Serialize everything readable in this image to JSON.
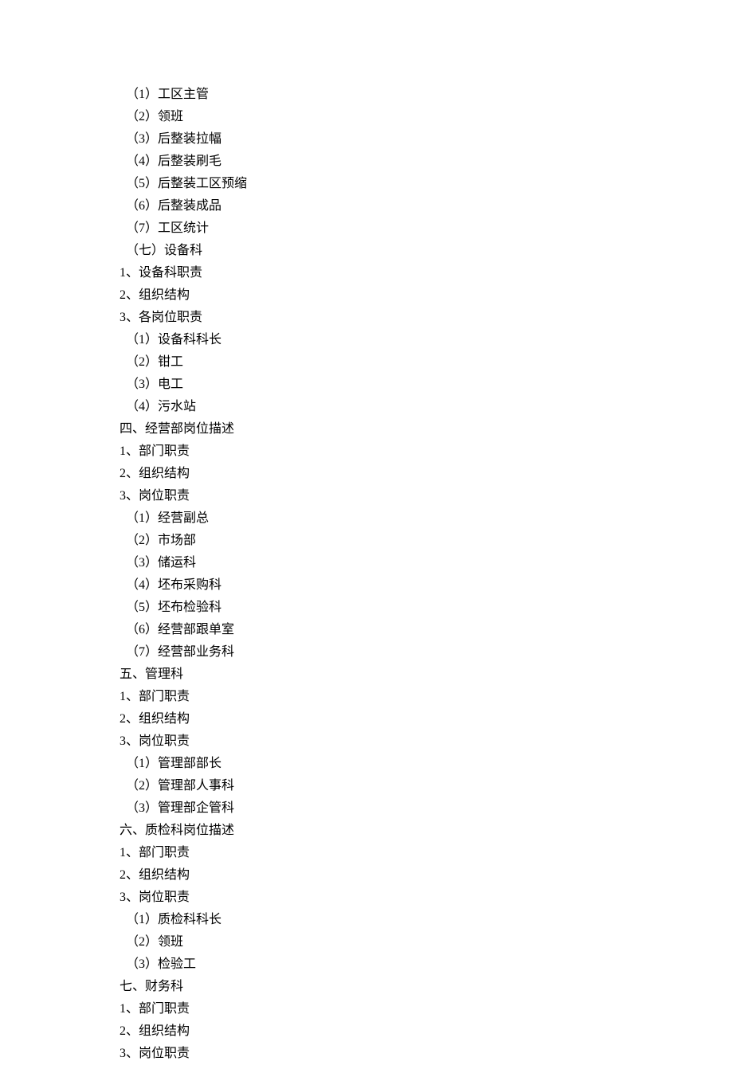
{
  "lines": [
    {
      "text": "（1）工区主管",
      "indent": 1
    },
    {
      "text": "（2）领班",
      "indent": 1
    },
    {
      "text": "（3）后整装拉幅",
      "indent": 1
    },
    {
      "text": "（4）后整装刷毛",
      "indent": 1
    },
    {
      "text": "（5）后整装工区预缩",
      "indent": 1
    },
    {
      "text": "（6）后整装成品",
      "indent": 1
    },
    {
      "text": "（7）工区统计",
      "indent": 1
    },
    {
      "text": "（七）设备科",
      "indent": 1
    },
    {
      "text": "1、设备科职责",
      "indent": 0
    },
    {
      "text": "2、组织结构",
      "indent": 0
    },
    {
      "text": "3、各岗位职责",
      "indent": 0
    },
    {
      "text": "（1）设备科科长",
      "indent": 1
    },
    {
      "text": "（2）钳工",
      "indent": 1
    },
    {
      "text": "（3）电工",
      "indent": 1
    },
    {
      "text": "（4）污水站",
      "indent": 1
    },
    {
      "text": "四、经营部岗位描述",
      "indent": 0
    },
    {
      "text": "1、部门职责",
      "indent": 0
    },
    {
      "text": "2、组织结构",
      "indent": 0
    },
    {
      "text": "3、岗位职责",
      "indent": 0
    },
    {
      "text": "（1）经营副总",
      "indent": 1
    },
    {
      "text": "（2）市场部",
      "indent": 1
    },
    {
      "text": "（3）储运科",
      "indent": 1
    },
    {
      "text": "（4）坯布采购科",
      "indent": 1
    },
    {
      "text": "（5）坯布检验科",
      "indent": 1
    },
    {
      "text": "（6）经营部跟单室",
      "indent": 1
    },
    {
      "text": "（7）经营部业务科",
      "indent": 1
    },
    {
      "text": "五、管理科",
      "indent": 0
    },
    {
      "text": "1、部门职责",
      "indent": 0
    },
    {
      "text": "2、组织结构",
      "indent": 0
    },
    {
      "text": "3、岗位职责",
      "indent": 0
    },
    {
      "text": "（1）管理部部长",
      "indent": 1
    },
    {
      "text": "（2）管理部人事科",
      "indent": 1
    },
    {
      "text": "（3）管理部企管科",
      "indent": 1
    },
    {
      "text": "六、质检科岗位描述",
      "indent": 0
    },
    {
      "text": "1、部门职责",
      "indent": 0
    },
    {
      "text": "2、组织结构",
      "indent": 0
    },
    {
      "text": "3、岗位职责",
      "indent": 0
    },
    {
      "text": "（1）质检科科长",
      "indent": 1
    },
    {
      "text": "（2）领班",
      "indent": 1
    },
    {
      "text": "（3）检验工",
      "indent": 1
    },
    {
      "text": "七、财务科",
      "indent": 0
    },
    {
      "text": "1、部门职责",
      "indent": 0
    },
    {
      "text": "2、组织结构",
      "indent": 0
    },
    {
      "text": "3、岗位职责",
      "indent": 0
    }
  ]
}
